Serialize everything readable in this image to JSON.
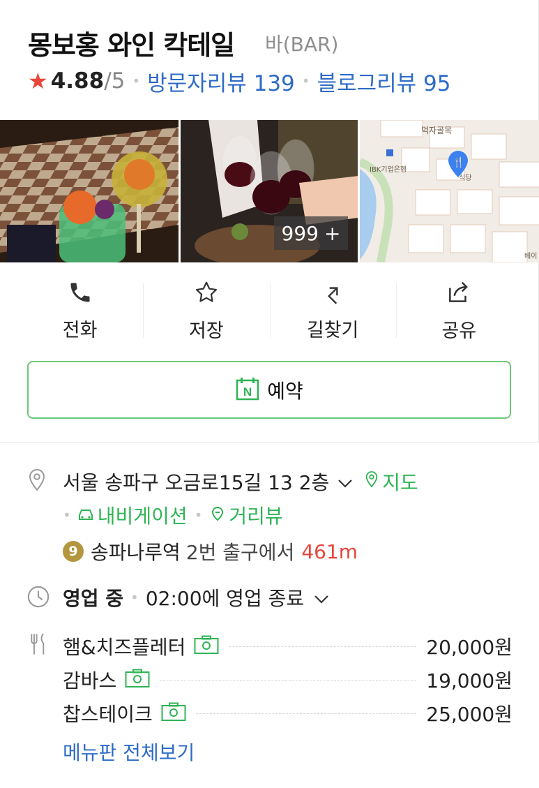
{
  "place": {
    "name": "몽보홍 와인 칵테일",
    "category": "바(BAR)",
    "rating": "4.88",
    "rating_max": "/5",
    "visitor_reviews": "방문자리뷰 139",
    "blog_reviews": "블로그리뷰 95"
  },
  "photos": {
    "count_label": "999",
    "count_plus": "+",
    "map_labels": {
      "food_alley": "먹자골목",
      "bank": "IBK기업은행",
      "restaurant": "식당",
      "corner": "베이"
    }
  },
  "actions": [
    {
      "label": "전화",
      "icon": "phone-icon"
    },
    {
      "label": "저장",
      "icon": "star-outline-icon"
    },
    {
      "label": "길찾기",
      "icon": "directions-icon"
    },
    {
      "label": "공유",
      "icon": "share-icon"
    }
  ],
  "reserve": {
    "label": "예약",
    "badge": "N"
  },
  "location": {
    "address": "서울 송파구 오금로15길 13 2층",
    "map_link": "지도",
    "navigation": "내비게이션",
    "street_view": "거리뷰",
    "subway_line": "9",
    "station": "송파나루역",
    "exit_text": "2번 출구에서",
    "distance": "461m"
  },
  "hours": {
    "status": "영업 중",
    "close_text": "02:00에 영업 종료"
  },
  "menu": {
    "items": [
      {
        "name": "햄&치즈플레터",
        "price": "20,000원"
      },
      {
        "name": "감바스",
        "price": "19,000원"
      },
      {
        "name": "찹스테이크",
        "price": "25,000원"
      }
    ],
    "view_all": "메뉴판 전체보기"
  },
  "colors": {
    "accent_green": "#2fb455",
    "link_blue": "#2e6bc6",
    "star_red": "#e8453c",
    "subway_line9": "#b3963d"
  }
}
